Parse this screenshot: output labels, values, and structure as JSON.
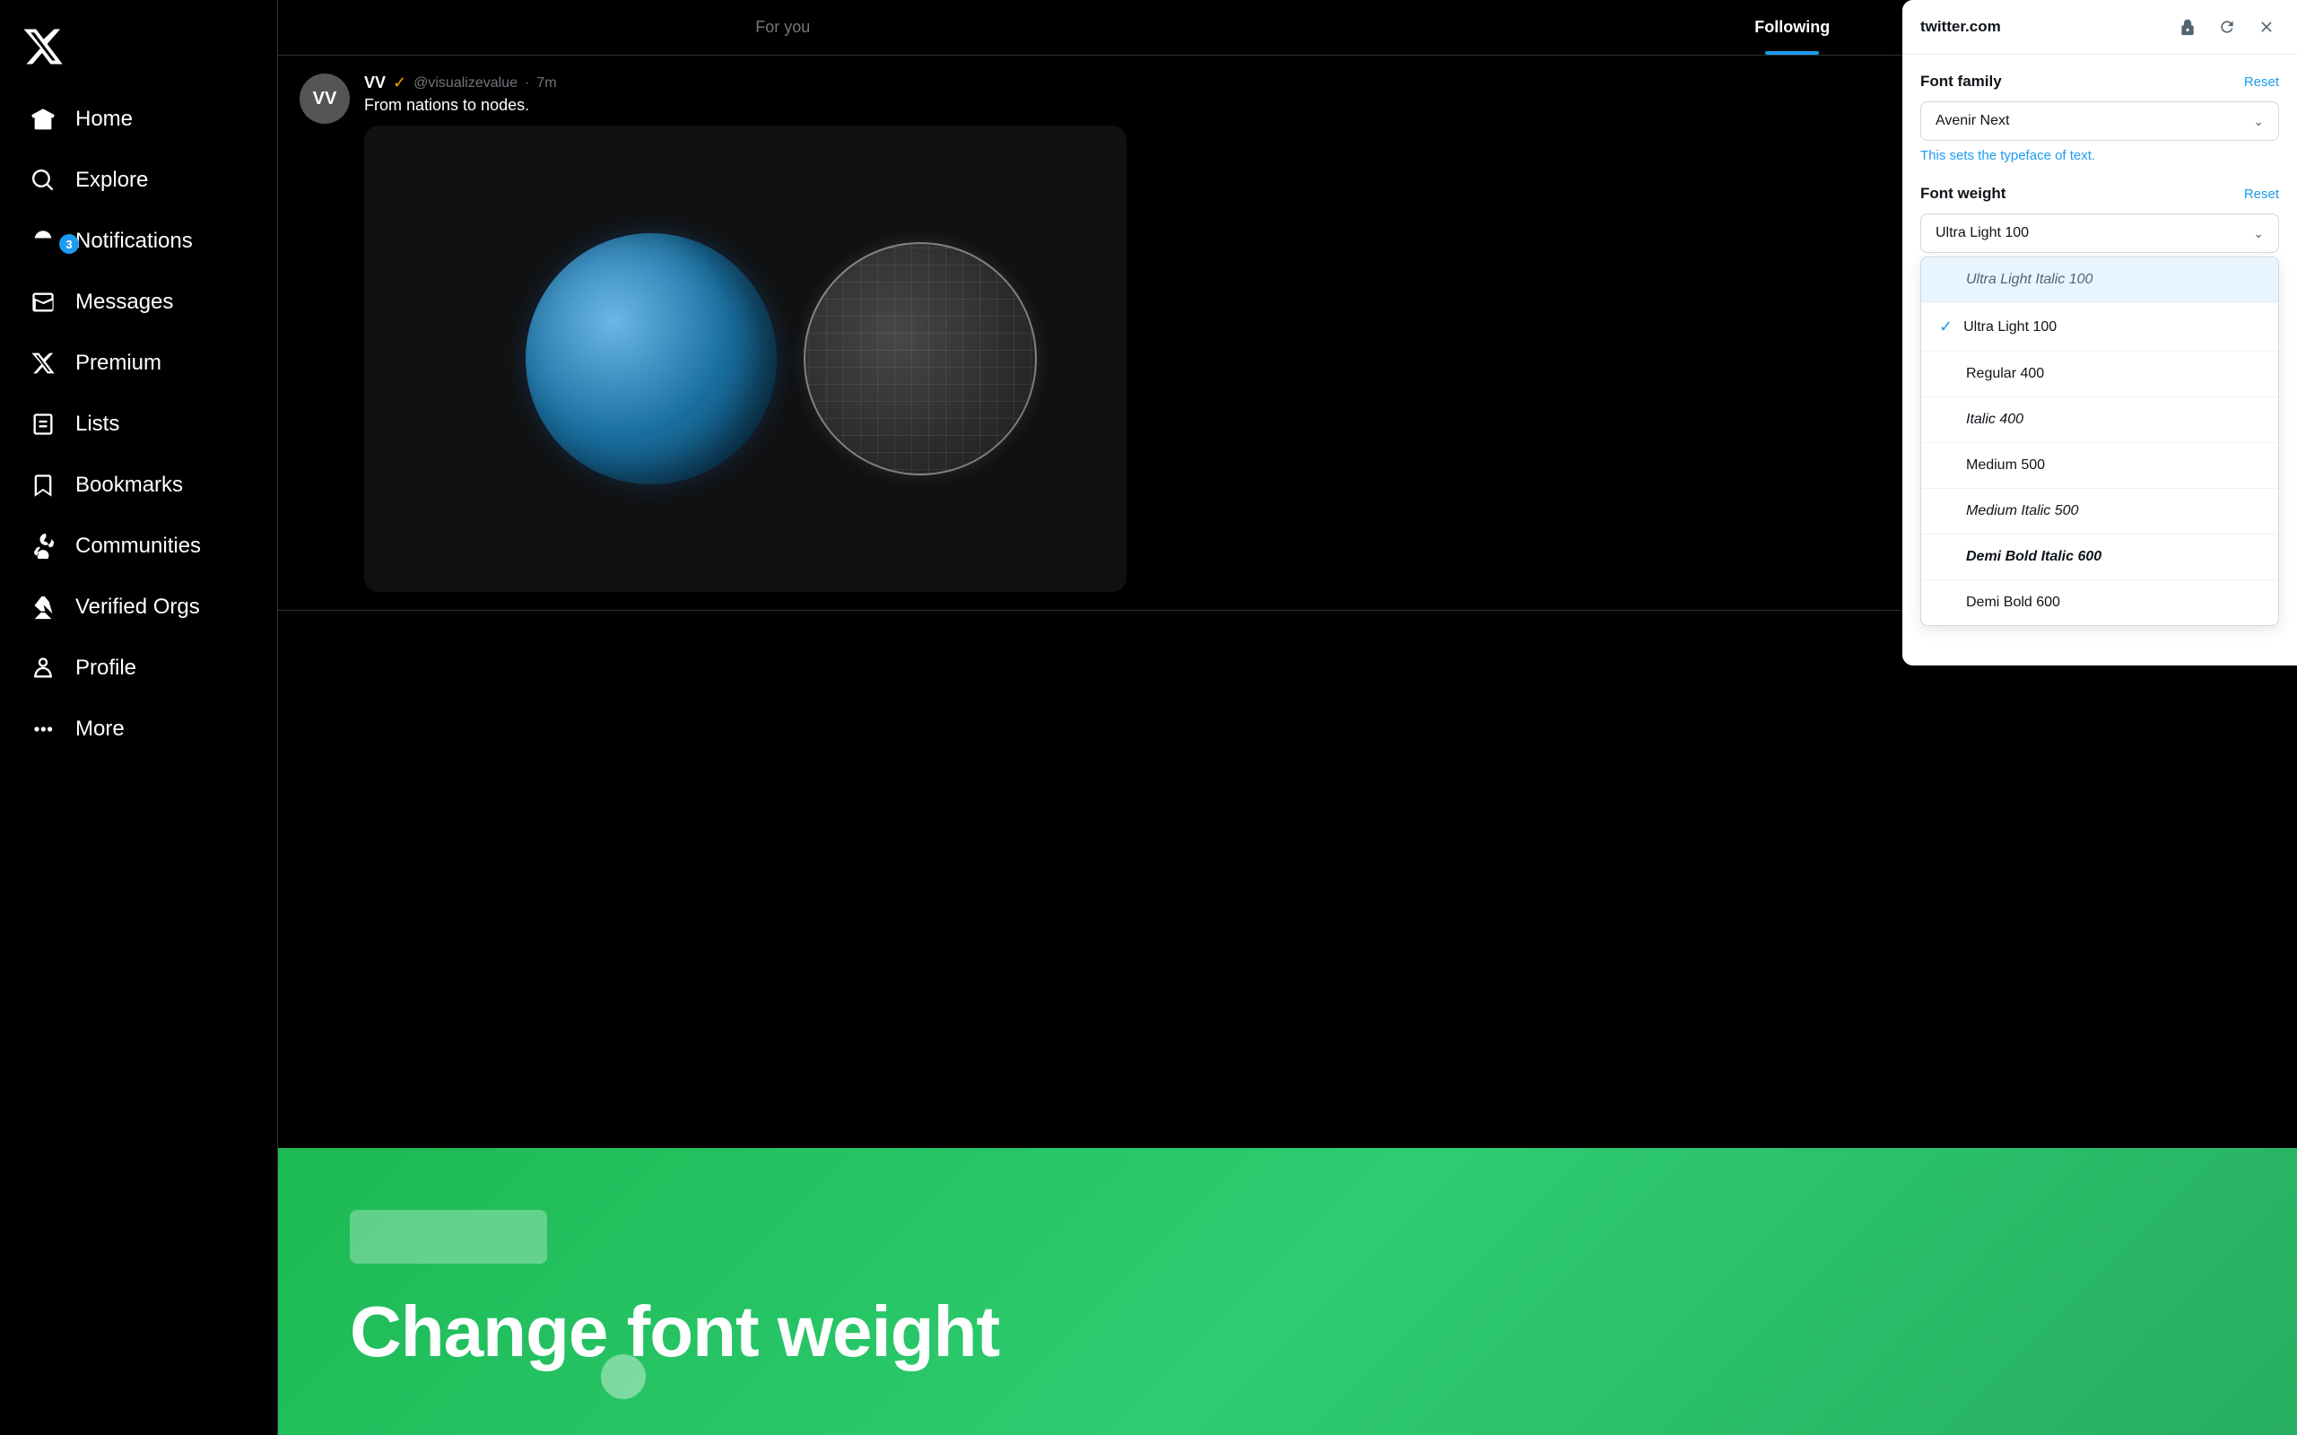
{
  "sidebar": {
    "logo_label": "X",
    "items": [
      {
        "id": "home",
        "label": "Home",
        "icon": "home"
      },
      {
        "id": "explore",
        "label": "Explore",
        "icon": "search"
      },
      {
        "id": "notifications",
        "label": "Notifications",
        "icon": "bell",
        "badge": "3"
      },
      {
        "id": "messages",
        "label": "Messages",
        "icon": "mail"
      },
      {
        "id": "premium",
        "label": "Premium",
        "icon": "x-premium"
      },
      {
        "id": "lists",
        "label": "Lists",
        "icon": "list"
      },
      {
        "id": "bookmarks",
        "label": "Bookmarks",
        "icon": "bookmark"
      },
      {
        "id": "communities",
        "label": "Communities",
        "icon": "community"
      },
      {
        "id": "verified",
        "label": "Verified Orgs",
        "icon": "lightning"
      },
      {
        "id": "profile",
        "label": "Profile",
        "icon": "person"
      },
      {
        "id": "more",
        "label": "More",
        "icon": "more"
      }
    ]
  },
  "tabs": [
    {
      "id": "for-you",
      "label": "For you",
      "active": false
    },
    {
      "id": "following",
      "label": "Following",
      "active": true
    }
  ],
  "tweet": {
    "avatar_initials": "VV",
    "author_name": "VV",
    "author_handle": "@visualizevalue",
    "time": "7m",
    "text": "From nations to nodes."
  },
  "popup": {
    "domain": "twitter.com",
    "font_family_section": {
      "title": "Font family",
      "reset_label": "Reset",
      "current_value": "Avenir Next",
      "hint": "This sets the typeface of text."
    },
    "font_weight_section": {
      "title": "Font weight",
      "reset_label": "Reset",
      "current_value": "Ultra Light 100",
      "dropdown_items": [
        {
          "id": "ultra-light-italic",
          "label": "Ultra Light Italic 100",
          "style": "highlighted"
        },
        {
          "id": "ultra-light",
          "label": "Ultra Light 100",
          "style": "selected",
          "checked": true
        },
        {
          "id": "regular",
          "label": "Regular 400",
          "style": "normal"
        },
        {
          "id": "italic",
          "label": "Italic 400",
          "style": "italic-style"
        },
        {
          "id": "medium",
          "label": "Medium 500",
          "style": "normal"
        },
        {
          "id": "medium-italic",
          "label": "Medium Italic 500",
          "style": "italic-style"
        },
        {
          "id": "demi-bold-italic",
          "label": "Demi Bold Italic 600",
          "style": "bold-italic-style"
        },
        {
          "id": "demi-bold",
          "label": "Demi Bold 600",
          "style": "normal"
        }
      ]
    }
  },
  "banner": {
    "title": "Change font weight"
  }
}
